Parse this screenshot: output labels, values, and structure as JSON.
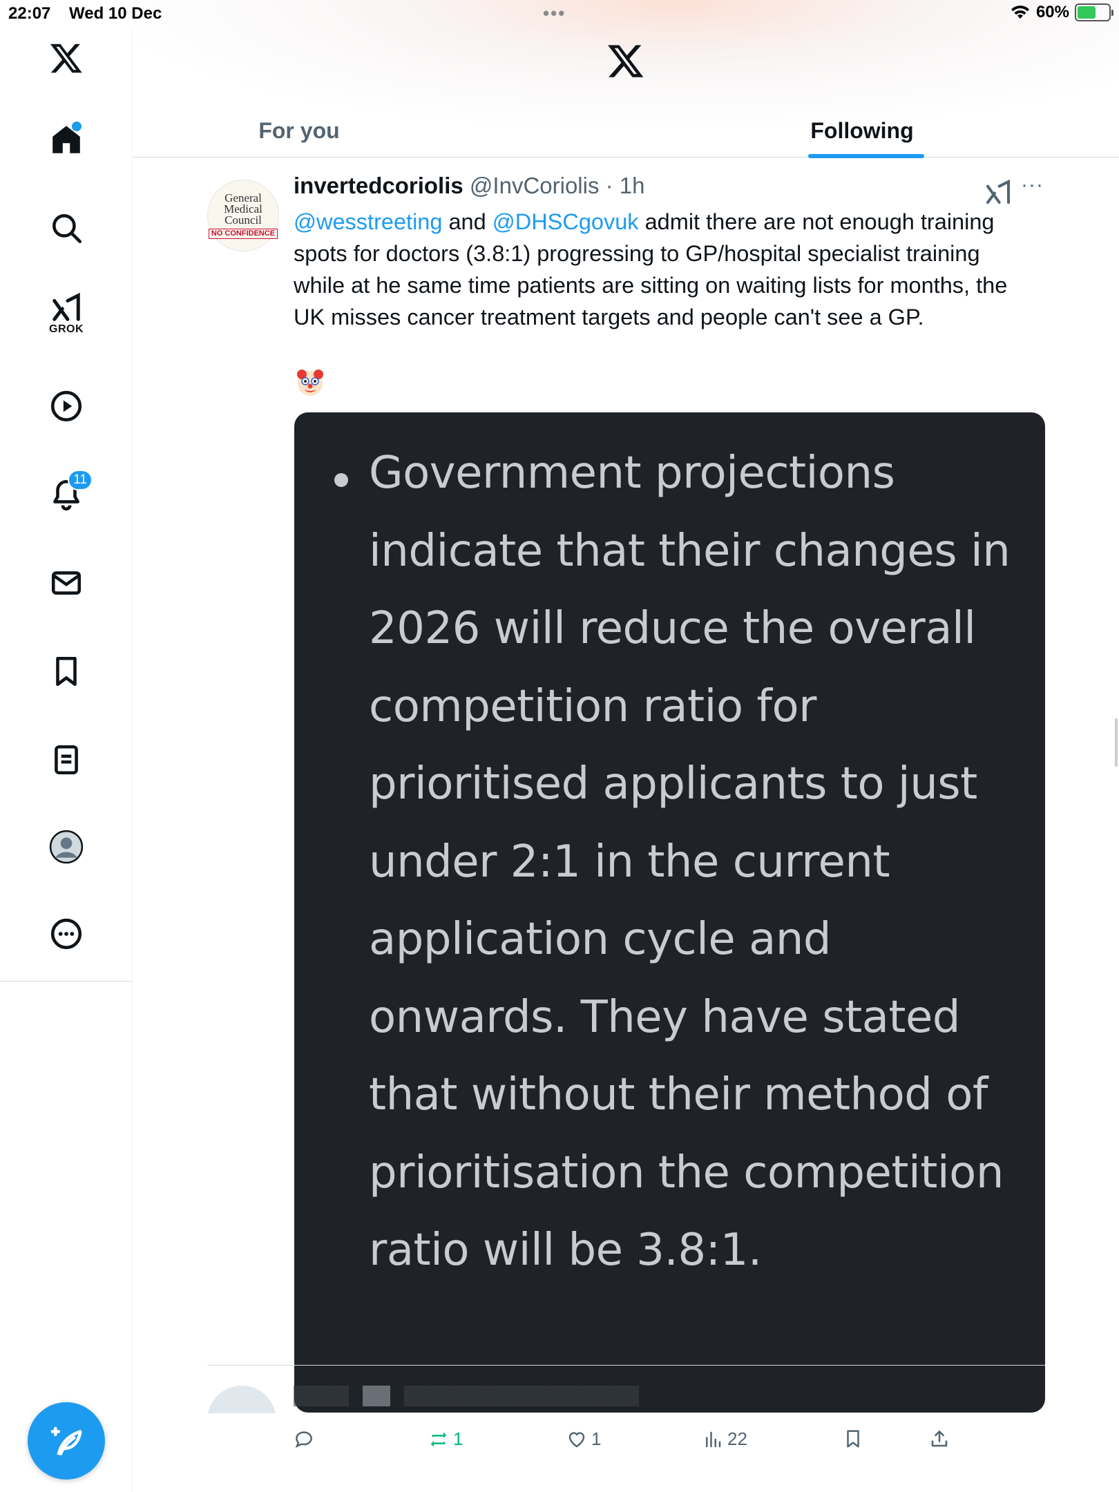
{
  "status_bar": {
    "time": "22:07",
    "date": "Wed 10 Dec",
    "battery": "60%",
    "battery_level": 0.6
  },
  "sidebar": {
    "items": [
      {
        "name": "home",
        "label": ""
      },
      {
        "name": "search",
        "label": ""
      },
      {
        "name": "grok",
        "label": "GROK"
      },
      {
        "name": "videos",
        "label": ""
      },
      {
        "name": "notifications",
        "badge": "11"
      },
      {
        "name": "messages",
        "label": ""
      },
      {
        "name": "bookmarks",
        "label": ""
      },
      {
        "name": "lists",
        "label": ""
      },
      {
        "name": "profile",
        "label": ""
      },
      {
        "name": "more",
        "label": ""
      }
    ]
  },
  "tabs": [
    {
      "label": "For you",
      "active": false
    },
    {
      "label": "Following",
      "active": true
    }
  ],
  "tweet": {
    "display_name": "invertedcoriolis",
    "handle": "@InvCoriolis",
    "time": "1h",
    "avatar_text": {
      "line1": "General",
      "line2": "Medical",
      "line3": "Council",
      "stamp": "NO CONFIDENCE"
    },
    "text_mention1": "@wesstreeting",
    "text_and": " and ",
    "text_mention2": "@DHSCgovuk",
    "text_body": " admit there are not enough training spots for doctors (3.8:1) progressing to GP/hospital specialist training while at he same time patients are sitting on waiting lists for months, the UK misses cancer treatment targets and people can't see a GP.",
    "emoji": "clown-face",
    "media_text": "Government projections indicate that their changes in 2026 will reduce the overall competition ratio for prioritised applicants to just under 2:1 in the current application cycle and onwards. They have stated that without their method of prioritisation the competition ratio will be 3.8:1.",
    "actions": {
      "replies": "",
      "reposts": "1",
      "likes": "1",
      "views": "22"
    }
  },
  "colors": {
    "accent": "#1d9bf0",
    "repost_green": "#00ba7c",
    "media_bg": "#1f2226",
    "muted": "#536471"
  }
}
